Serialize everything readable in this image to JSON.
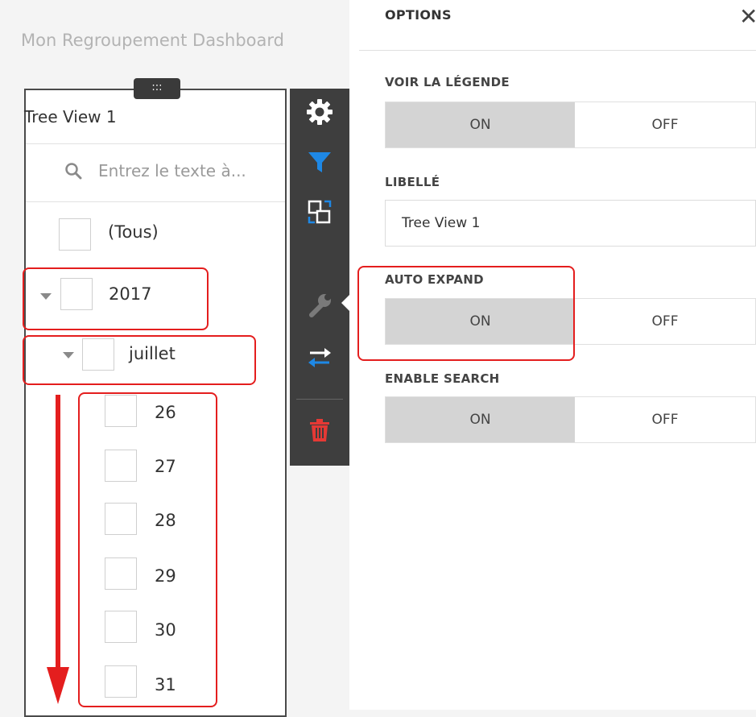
{
  "dashboard": {
    "title": "Mon Regroupement Dashboard",
    "handle_glyph": ":::"
  },
  "tree_view": {
    "title": "Tree View 1",
    "search_placeholder": "Entrez le texte à...",
    "all_label": "(Tous)",
    "year_label": "2017",
    "month_label": "juillet",
    "days": [
      "26",
      "27",
      "28",
      "29",
      "30",
      "31"
    ]
  },
  "toolbar": {
    "items": [
      "gear-icon",
      "filter-icon",
      "convert-icon",
      "wrench-icon",
      "swap-icon",
      "trash-icon"
    ],
    "colors": {
      "filter": "#1e88e5",
      "trash": "#e53935",
      "default": "#ffffff"
    }
  },
  "options": {
    "header": "OPTIONS",
    "close_glyph": "✕",
    "show_legend": {
      "label": "VOIR LA LÉGENDE",
      "on": "ON",
      "off": "OFF",
      "value": "ON"
    },
    "caption": {
      "label": "LIBELLÉ",
      "value": "Tree View 1"
    },
    "auto_expand": {
      "label": "AUTO EXPAND",
      "on": "ON",
      "off": "OFF",
      "value": "ON"
    },
    "enable_search": {
      "label": "ENABLE SEARCH",
      "on": "ON",
      "off": "OFF",
      "value": "ON"
    }
  },
  "annotation": {
    "highlight_color": "#e41e1e"
  }
}
